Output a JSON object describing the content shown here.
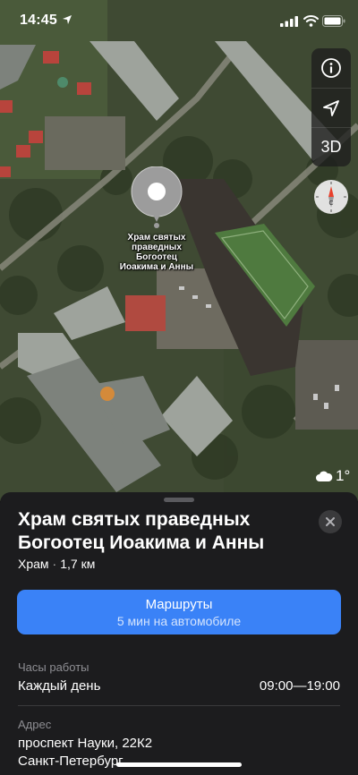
{
  "status_bar": {
    "time": "14:45"
  },
  "map": {
    "pin_label_lines": [
      "Храм святых",
      "праведных",
      "Богоотец",
      "Иоакима и Анны"
    ],
    "controls": {
      "info_icon": "info-icon",
      "location_icon": "location-arrow-icon",
      "mode_3d_label": "3D",
      "compass_icon": "compass-icon"
    },
    "weather": {
      "icon": "cloud-icon",
      "temperature": "1°"
    }
  },
  "place": {
    "title": "Храм святых праведных Богоотец Иоакима и Анны",
    "category": "Храм",
    "distance": "1,7 км",
    "close_icon": "close-icon"
  },
  "route_button": {
    "label": "Маршруты",
    "sublabel": "5 мин на автомобиле"
  },
  "hours": {
    "label": "Часы работы",
    "days": "Каждый день",
    "time_range": "09:00—19:00"
  },
  "address": {
    "label": "Адрес",
    "line1": "проспект Науки, 22К2",
    "line2": "Санкт-Петербург"
  },
  "colors": {
    "accent": "#3a82f7",
    "sheet_bg": "#1c1c1e",
    "secondary_text": "#8e8e93",
    "compass_red": "#e8412c"
  }
}
